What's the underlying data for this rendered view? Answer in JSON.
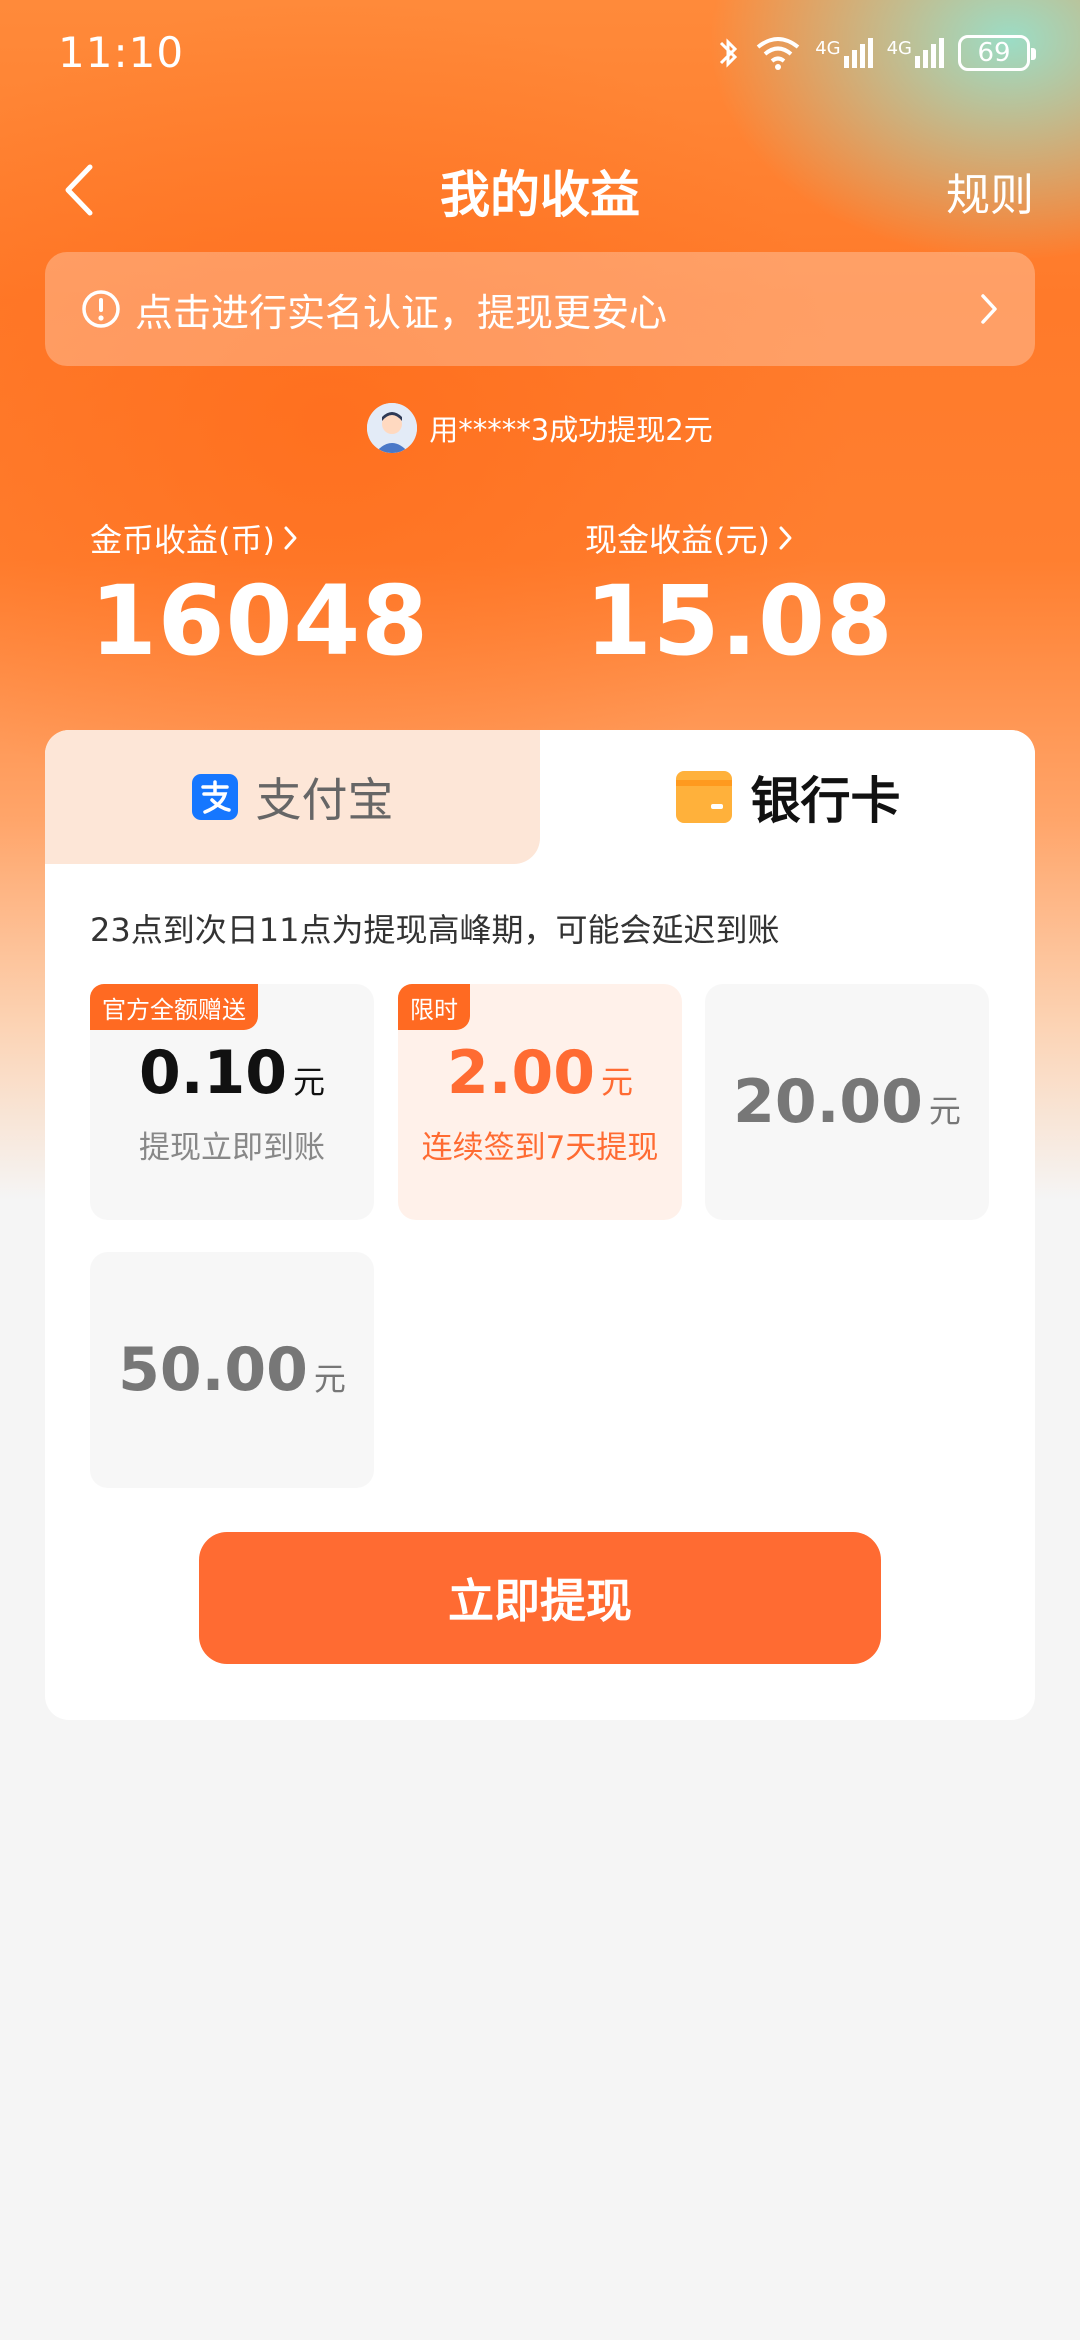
{
  "status_bar": {
    "time": "11:10",
    "network_1": "4G",
    "network_2": "4G",
    "battery": "69",
    "icons": [
      "bluetooth-icon",
      "wifi-icon",
      "signal-4g-icon",
      "signal-4g-icon",
      "battery-icon"
    ]
  },
  "header": {
    "title": "我的收益",
    "rules_label": "规则"
  },
  "verify_banner": {
    "text": "点击进行实名认证，提现更安心"
  },
  "withdraw_notice": {
    "text": "用*****3成功提现2元"
  },
  "stats": {
    "coin": {
      "label": "金币收益(币)",
      "value": "16048"
    },
    "cash": {
      "label": "现金收益(元)",
      "value": "15.08"
    }
  },
  "tabs": {
    "alipay": "支付宝",
    "bank": "银行卡",
    "selected": "bank"
  },
  "peak_notice": "23点到次日11点为提现高峰期，可能会延迟到账",
  "amounts": [
    {
      "badge": "官方全额赠送",
      "value": "0.10",
      "unit": "元",
      "sub": "提现立即到账"
    },
    {
      "badge": "限时",
      "value": "2.00",
      "unit": "元",
      "sub": "连续签到7天提现"
    },
    {
      "value": "20.00",
      "unit": "元"
    },
    {
      "value": "50.00",
      "unit": "元"
    }
  ],
  "cta_label": "立即提现",
  "colors": {
    "accent": "#ff6b32",
    "alipay_blue": "#1677ff",
    "bank_yellow": "#ffb13b"
  }
}
